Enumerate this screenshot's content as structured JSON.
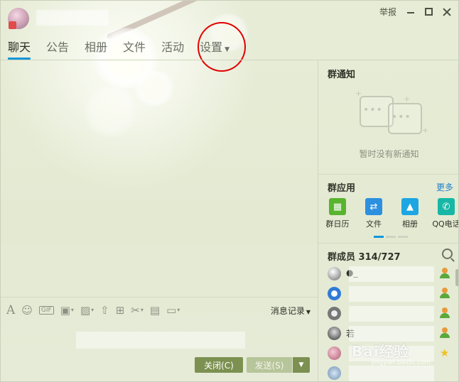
{
  "header": {
    "report_label": "举报",
    "tabs": [
      {
        "label": "聊天",
        "active": true
      },
      {
        "label": "公告"
      },
      {
        "label": "相册"
      },
      {
        "label": "文件"
      },
      {
        "label": "活动"
      },
      {
        "label": "设置",
        "has_dropdown": true
      }
    ]
  },
  "toolbar": {
    "gif_label": "GIF",
    "message_record_label": "消息记录"
  },
  "buttons": {
    "close_label": "关闭(C)",
    "send_label": "发送(S)"
  },
  "group_notice": {
    "title": "群通知",
    "empty_text": "暂时没有新通知"
  },
  "group_apps": {
    "title": "群应用",
    "more_label": "更多",
    "items": [
      {
        "label": "群日历",
        "icon": "calendar-icon",
        "color": "#58b42e"
      },
      {
        "label": "文件",
        "icon": "file-transfer-icon",
        "color": "#2d8fe0"
      },
      {
        "label": "相册",
        "icon": "photo-album-icon",
        "color": "#1da6e2"
      },
      {
        "label": "QQ电话",
        "icon": "phone-icon",
        "color": "#17b7a6"
      }
    ]
  },
  "members": {
    "title": "群成员 314/727",
    "rows": [
      {
        "name": "●_",
        "role": "member"
      },
      {
        "name": "",
        "role": "member"
      },
      {
        "name": "",
        "role": "member"
      },
      {
        "name": "若",
        "role": "member"
      },
      {
        "name": "",
        "role": "owner"
      },
      {
        "name": "",
        "role": "member"
      }
    ]
  },
  "colors": {
    "accent": "#1296db",
    "button_green": "#7c9151",
    "annotation_circle": "#e10000"
  },
  "watermark": {
    "main": "Bai经验",
    "sub": "jingyan.baidu.com"
  }
}
